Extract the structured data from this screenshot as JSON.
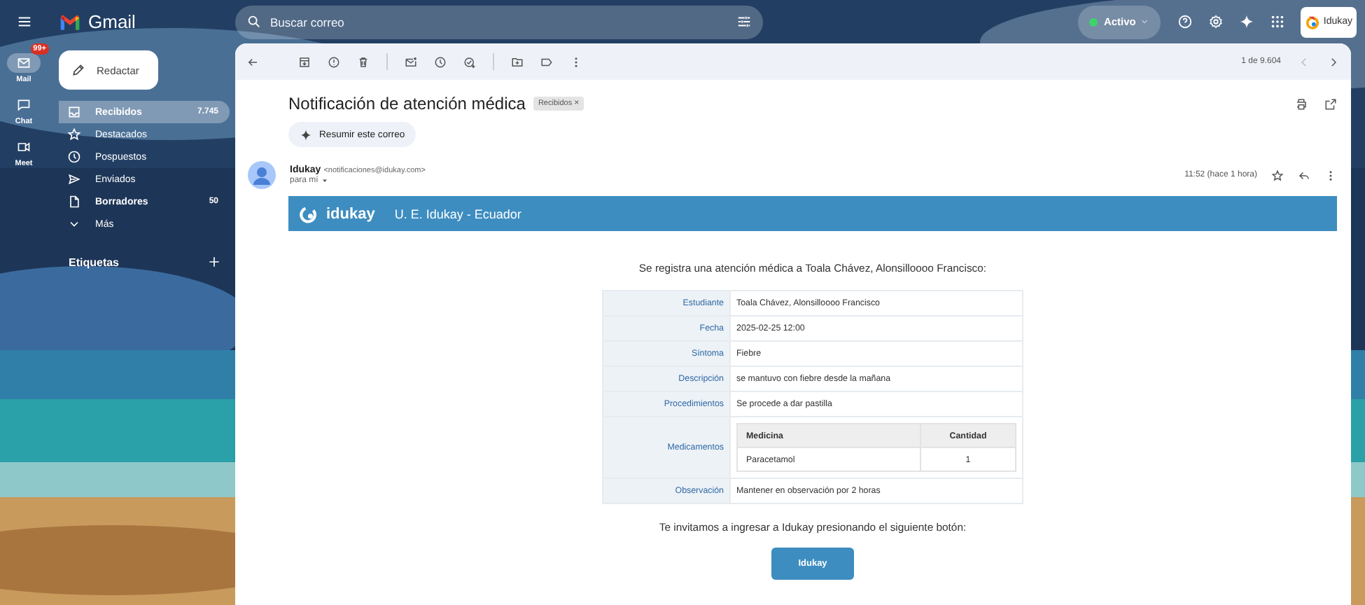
{
  "rail": [
    {
      "label": "Mail",
      "badge": "99+",
      "selected": true,
      "kind": "mail"
    },
    {
      "label": "Chat",
      "selected": false,
      "kind": "chat"
    },
    {
      "label": "Meet",
      "selected": false,
      "kind": "meet"
    }
  ],
  "brand": "Gmail",
  "search": {
    "placeholder": "Buscar correo"
  },
  "status": "Activo",
  "account": "Idukay",
  "compose": "Redactar",
  "folders": [
    {
      "label": "Recibidos",
      "count": "7.745",
      "selected": true,
      "unread": true,
      "kind": "inbox"
    },
    {
      "label": "Destacados",
      "selected": false,
      "unread": false,
      "kind": "star"
    },
    {
      "label": "Pospuestos",
      "selected": false,
      "unread": false,
      "kind": "clock"
    },
    {
      "label": "Enviados",
      "selected": false,
      "unread": false,
      "kind": "send"
    },
    {
      "label": "Borradores",
      "count": "50",
      "selected": false,
      "unread": true,
      "kind": "draft"
    },
    {
      "label": "Más",
      "selected": false,
      "unread": false,
      "kind": "more"
    }
  ],
  "labels_heading": "Etiquetas",
  "pager": "1 de 9.604",
  "message": {
    "subject": "Notificación de atención médica",
    "chip": "Recibidos",
    "chip_close": "×",
    "summarize": "Resumir este correo",
    "sender": "Idukay",
    "email": "<notificaciones@idukay.com>",
    "to": "para mí",
    "time": "11:52 (hace 1 hora)"
  },
  "body": {
    "logo": "idukay",
    "title": "U. E. Idukay - Ecuador",
    "intro": "Se registra una atención médica a Toala Chávez, Alonsilloooo Francisco:",
    "rows": [
      {
        "label": "Estudiante",
        "kind": "text",
        "value": "Toala Chávez, Alonsilloooo Francisco"
      },
      {
        "label": "Fecha",
        "kind": "text",
        "value": "2025-02-25 12:00"
      },
      {
        "label": "Síntoma",
        "kind": "text",
        "value": "Fiebre"
      },
      {
        "label": "Descripción",
        "kind": "text",
        "value": "se mantuvo con fiebre desde la mañana"
      },
      {
        "label": "Procedimientos",
        "kind": "text",
        "value": "Se procede a dar pastilla"
      },
      {
        "label": "Medicamentos",
        "kind": "table",
        "columns": [
          "Medicina",
          "Cantidad"
        ],
        "items": [
          [
            "Paracetamol",
            "1"
          ]
        ]
      },
      {
        "label": "Observación",
        "kind": "text",
        "value": "Mantener en observación por 2 horas"
      }
    ],
    "invite": "Te invitamos a ingresar a Idukay presionando el siguiente botón:",
    "button": "Idukay"
  }
}
